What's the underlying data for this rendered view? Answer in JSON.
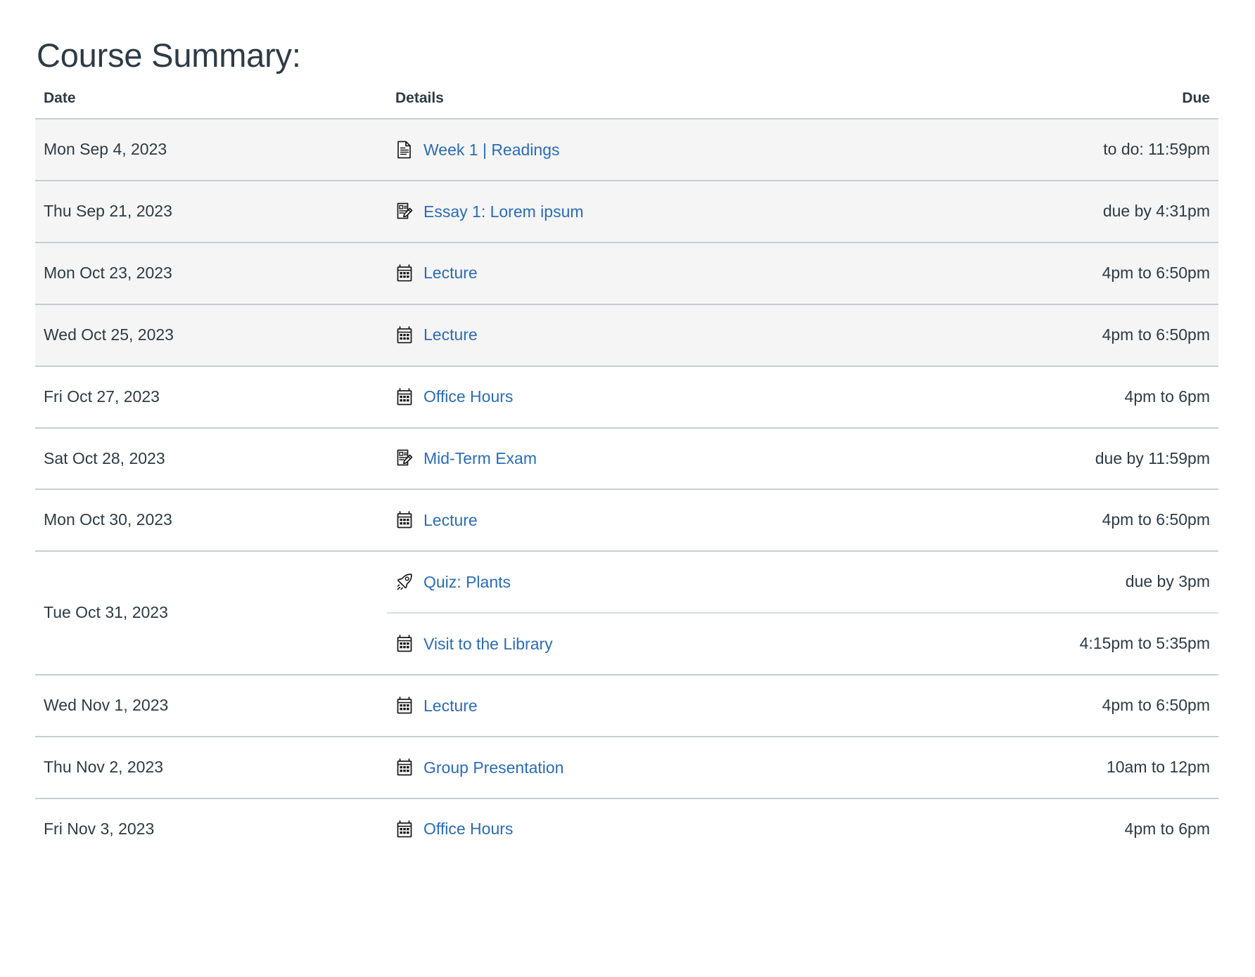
{
  "page": {
    "title": "Course Summary:"
  },
  "table": {
    "columns": {
      "date": "Date",
      "details": "Details",
      "due": "Due"
    },
    "link_color": "#2b6cb8",
    "shaded_row_color": "#f5f5f5",
    "border_color": "#c7cdd1",
    "rows": [
      {
        "date": "Mon Sep 4, 2023",
        "shaded": true,
        "events": [
          {
            "icon": "document-icon",
            "title": "Week 1 | Readings",
            "due": "to do: 11:59pm"
          }
        ]
      },
      {
        "date": "Thu Sep 21, 2023",
        "shaded": true,
        "events": [
          {
            "icon": "assignment-icon",
            "title": "Essay 1: Lorem ipsum",
            "due": "due by 4:31pm"
          }
        ]
      },
      {
        "date": "Mon Oct 23, 2023",
        "shaded": true,
        "events": [
          {
            "icon": "calendar-icon",
            "title": "Lecture",
            "due": "4pm to 6:50pm"
          }
        ]
      },
      {
        "date": "Wed Oct 25, 2023",
        "shaded": true,
        "events": [
          {
            "icon": "calendar-icon",
            "title": "Lecture",
            "due": "4pm to 6:50pm"
          }
        ]
      },
      {
        "date": "Fri Oct 27, 2023",
        "shaded": false,
        "events": [
          {
            "icon": "calendar-icon",
            "title": "Office Hours",
            "due": "4pm to 6pm"
          }
        ]
      },
      {
        "date": "Sat Oct 28, 2023",
        "shaded": false,
        "events": [
          {
            "icon": "assignment-icon",
            "title": "Mid-Term Exam",
            "due": "due by 11:59pm"
          }
        ]
      },
      {
        "date": "Mon Oct 30, 2023",
        "shaded": false,
        "events": [
          {
            "icon": "calendar-icon",
            "title": "Lecture",
            "due": "4pm to 6:50pm"
          }
        ]
      },
      {
        "date": "Tue Oct 31, 2023",
        "shaded": false,
        "events": [
          {
            "icon": "quiz-rocket-icon",
            "title": "Quiz: Plants",
            "due": "due by 3pm"
          },
          {
            "icon": "calendar-icon",
            "title": "Visit to the Library",
            "due": "4:15pm to 5:35pm"
          }
        ]
      },
      {
        "date": "Wed Nov 1, 2023",
        "shaded": false,
        "events": [
          {
            "icon": "calendar-icon",
            "title": "Lecture",
            "due": "4pm to 6:50pm"
          }
        ]
      },
      {
        "date": "Thu Nov 2, 2023",
        "shaded": false,
        "events": [
          {
            "icon": "calendar-icon",
            "title": "Group Presentation",
            "due": "10am to 12pm"
          }
        ]
      },
      {
        "date": "Fri Nov 3, 2023",
        "shaded": false,
        "events": [
          {
            "icon": "calendar-icon",
            "title": "Office Hours",
            "due": "4pm to 6pm"
          }
        ]
      }
    ]
  }
}
